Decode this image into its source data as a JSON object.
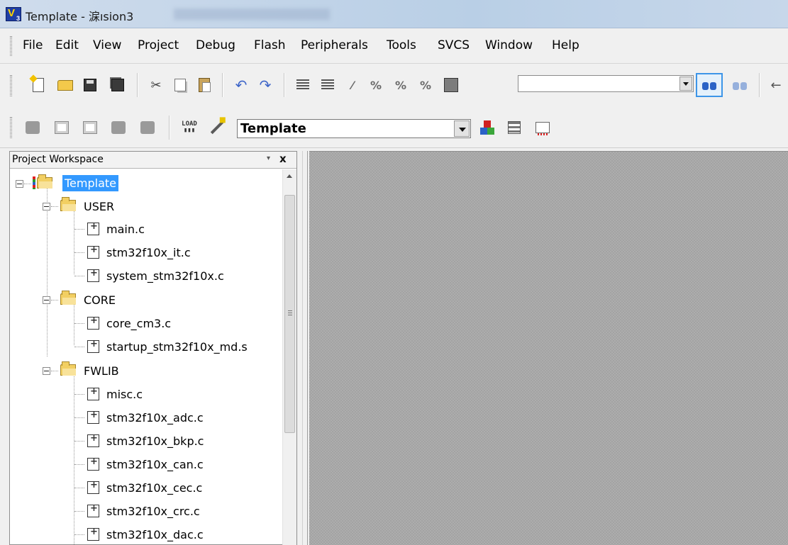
{
  "titlebar": {
    "title": "Template  - 淭ısion3",
    "app_icon": "uvision-icon"
  },
  "menubar": {
    "items": [
      {
        "label": "File"
      },
      {
        "label": "Edit"
      },
      {
        "label": "View"
      },
      {
        "label": "Project"
      },
      {
        "label": "Debug"
      },
      {
        "label": "Flash"
      },
      {
        "label": "Peripherals"
      },
      {
        "label": "Tools"
      },
      {
        "label": "SVCS"
      },
      {
        "label": "Window"
      },
      {
        "label": "Help"
      }
    ]
  },
  "toolbar_file": {
    "icons": [
      "new-file-icon",
      "open-folder-icon",
      "save-icon",
      "save-all-icon",
      "cut-icon",
      "copy-icon",
      "paste-icon",
      "undo-icon",
      "redo-icon",
      "indent-icon",
      "unindent-icon",
      "bookmark-icon",
      "bookmark-prev-icon",
      "bookmark-next-icon",
      "bookmark-clear-icon",
      "find-in-files-icon",
      "find-icon",
      "incremental-find-icon",
      "navigate-back-icon"
    ],
    "find_value": ""
  },
  "toolbar_build": {
    "icons": [
      "translate-icon",
      "build-icon",
      "rebuild-icon",
      "batch-build-icon",
      "stop-build-icon",
      "download-icon",
      "target-options-icon",
      "manage-components-icon",
      "books-icon",
      "pack-installer-icon"
    ],
    "target_value": "Template"
  },
  "workspace": {
    "title": "Project Workspace",
    "pin_glyph": "▾",
    "close_glyph": "x",
    "tree": {
      "root": "Template",
      "groups": [
        {
          "name": "USER",
          "files": [
            "main.c",
            "stm32f10x_it.c",
            "system_stm32f10x.c"
          ]
        },
        {
          "name": "CORE",
          "files": [
            "core_cm3.c",
            "startup_stm32f10x_md.s"
          ]
        },
        {
          "name": "FWLIB",
          "files": [
            "misc.c",
            "stm32f10x_adc.c",
            "stm32f10x_bkp.c",
            "stm32f10x_can.c",
            "stm32f10x_cec.c",
            "stm32f10x_crc.c",
            "stm32f10x_dac.c"
          ]
        }
      ]
    }
  },
  "colors": {
    "selection": "#3399ff",
    "editor_bg": "#adadad",
    "titlebar_bg": "#c7d7ea"
  }
}
